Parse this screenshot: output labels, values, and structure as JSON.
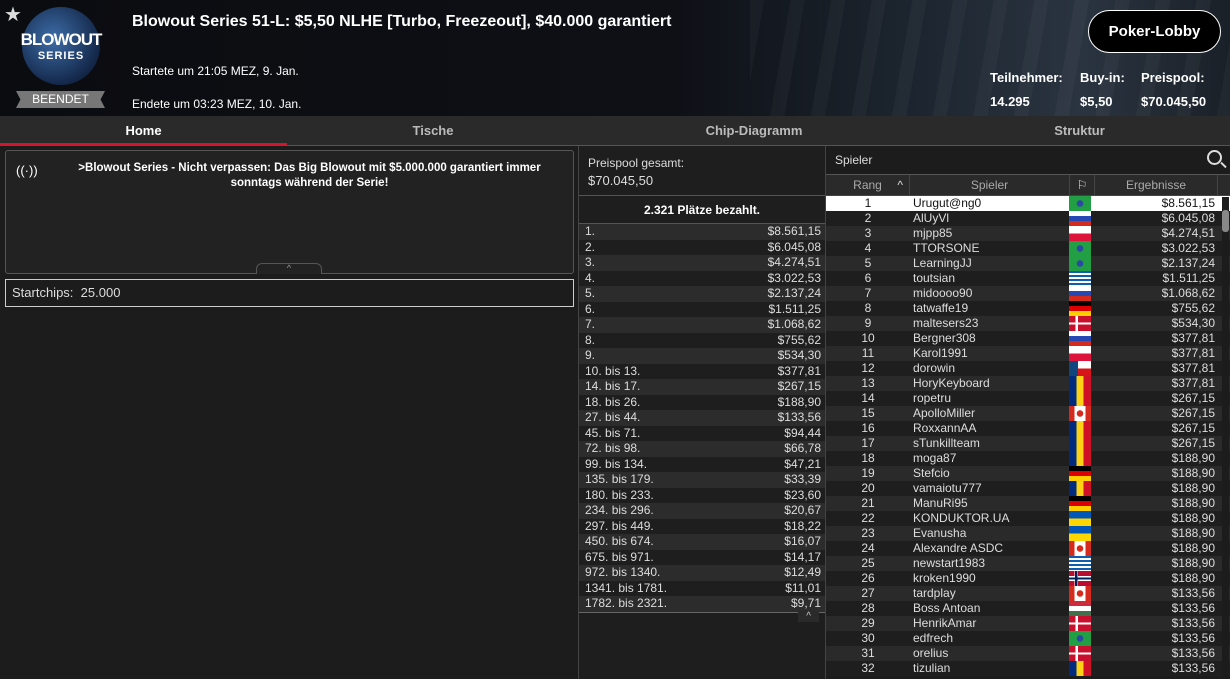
{
  "header": {
    "title": "Blowout Series 51-L: $5,50 NLHE [Turbo, Freezeout], $40.000 garantiert",
    "logo_line1": "BLOWOUT",
    "logo_line2": "SERIES",
    "status": "BEENDET",
    "started": "Startete um 21:05 MEZ, 9. Jan.",
    "ended": "Endete um 03:23 MEZ, 10. Jan.",
    "lobby_button": "Poker-Lobby",
    "stats": [
      {
        "label": "Teilnehmer:",
        "value": "14.295"
      },
      {
        "label": "Buy-in:",
        "value": "$5,50"
      },
      {
        "label": "Preispool:",
        "value": "$70.045,50"
      }
    ]
  },
  "tabs": [
    "Home",
    "Tische",
    "Chip-Diagramm",
    "Struktur"
  ],
  "news": ">Blowout Series - Nicht verpassen: Das Big Blowout mit $5.000.000 garantiert immer sonntags während der Serie!",
  "startchips": {
    "label": "Startchips:",
    "value": "25.000"
  },
  "prizes": {
    "pool_label": "Preispool gesamt:",
    "pool_value": "$70.045,50",
    "paid": "2.321 Plätze bezahlt.",
    "rows": [
      [
        "1.",
        "$8.561,15"
      ],
      [
        "2.",
        "$6.045,08"
      ],
      [
        "3.",
        "$4.274,51"
      ],
      [
        "4.",
        "$3.022,53"
      ],
      [
        "5.",
        "$2.137,24"
      ],
      [
        "6.",
        "$1.511,25"
      ],
      [
        "7.",
        "$1.068,62"
      ],
      [
        "8.",
        "$755,62"
      ],
      [
        "9.",
        "$534,30"
      ],
      [
        "10. bis 13.",
        "$377,81"
      ],
      [
        "14. bis 17.",
        "$267,15"
      ],
      [
        "18. bis 26.",
        "$188,90"
      ],
      [
        "27. bis 44.",
        "$133,56"
      ],
      [
        "45. bis 71.",
        "$94,44"
      ],
      [
        "72. bis 98.",
        "$66,78"
      ],
      [
        "99. bis 134.",
        "$47,21"
      ],
      [
        "135. bis 179.",
        "$33,39"
      ],
      [
        "180. bis 233.",
        "$23,60"
      ],
      [
        "234. bis 296.",
        "$20,67"
      ],
      [
        "297. bis 449.",
        "$18,22"
      ],
      [
        "450. bis 674.",
        "$16,07"
      ],
      [
        "675. bis 971.",
        "$14,17"
      ],
      [
        "972. bis 1340.",
        "$12,49"
      ],
      [
        "1341. bis 1781.",
        "$11,01"
      ],
      [
        "1782. bis 2321.",
        "$9,71"
      ]
    ]
  },
  "players": {
    "search_label": "Spieler",
    "columns": [
      "Rang",
      "Spieler",
      "Ergebnisse"
    ],
    "rows": [
      [
        "1",
        "Urugut@ng0",
        "br",
        "$8.561,15"
      ],
      [
        "2",
        "AlUyVl",
        "ru",
        "$6.045,08"
      ],
      [
        "3",
        "mjpp85",
        "pl",
        "$4.274,51"
      ],
      [
        "4",
        "TTORSONE",
        "br",
        "$3.022,53"
      ],
      [
        "5",
        "LearningJJ",
        "br",
        "$2.137,24"
      ],
      [
        "6",
        "toutsian",
        "gr",
        "$1.511,25"
      ],
      [
        "7",
        "midoooo90",
        "ru",
        "$1.068,62"
      ],
      [
        "8",
        "tatwaffe19",
        "de",
        "$755,62"
      ],
      [
        "9",
        "maltesers23",
        "dk",
        "$534,30"
      ],
      [
        "10",
        "Bergner308",
        "ru",
        "$377,81"
      ],
      [
        "11",
        "Karol1991",
        "pl",
        "$377,81"
      ],
      [
        "12",
        "dorowin",
        "cz",
        "$377,81"
      ],
      [
        "13",
        "HoryKeyboard",
        "ro",
        "$377,81"
      ],
      [
        "14",
        "ropetru",
        "ro",
        "$267,15"
      ],
      [
        "15",
        "ApolloMiller",
        "ca",
        "$267,15"
      ],
      [
        "16",
        "RoxxannAA",
        "ro",
        "$267,15"
      ],
      [
        "17",
        "sTunkillteam",
        "ro",
        "$267,15"
      ],
      [
        "18",
        "moga87",
        "ro",
        "$188,90"
      ],
      [
        "19",
        "Stefcio",
        "de",
        "$188,90"
      ],
      [
        "20",
        "vamaiotu777",
        "ro",
        "$188,90"
      ],
      [
        "21",
        "ManuRi95",
        "de",
        "$188,90"
      ],
      [
        "22",
        "KONDUKTOR.UA",
        "ua",
        "$188,90"
      ],
      [
        "23",
        "Evanusha",
        "ua",
        "$188,90"
      ],
      [
        "24",
        "Alexandre ASDC",
        "ca",
        "$188,90"
      ],
      [
        "25",
        "newstart1983",
        "gr",
        "$188,90"
      ],
      [
        "26",
        "kroken1990",
        "no",
        "$188,90"
      ],
      [
        "27",
        "tardplay",
        "ca",
        "$133,56"
      ],
      [
        "28",
        "Boss Antoan",
        "hu",
        "$133,56"
      ],
      [
        "29",
        "HenrikAmar",
        "dk",
        "$133,56"
      ],
      [
        "30",
        "edfrech",
        "br",
        "$133,56"
      ],
      [
        "31",
        "orelius",
        "dk",
        "$133,56"
      ],
      [
        "32",
        "tizulian",
        "ro",
        "$133,56"
      ]
    ]
  },
  "colors": {
    "accent": "#d3162b"
  }
}
